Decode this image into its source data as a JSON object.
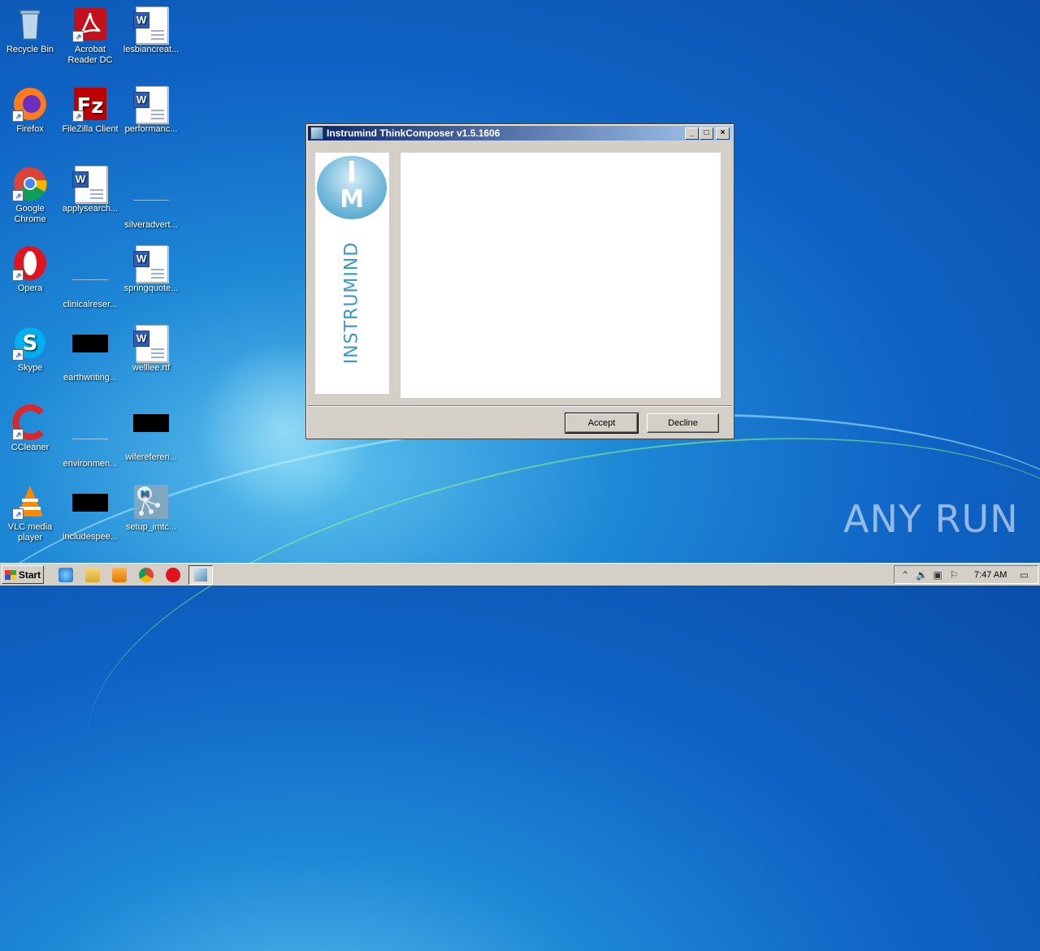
{
  "desktop": {
    "icons": [
      {
        "label": "Recycle Bin",
        "icon": "recycle-bin-icon"
      },
      {
        "label": "Acrobat Reader DC",
        "icon": "acrobat-icon"
      },
      {
        "label": "lesbiancreat...",
        "icon": "word-document-icon"
      },
      {
        "label": "Firefox",
        "icon": "firefox-icon"
      },
      {
        "label": "FileZilla Client",
        "icon": "filezilla-icon"
      },
      {
        "label": "performanc...",
        "icon": "word-document-icon"
      },
      {
        "label": "Google Chrome",
        "icon": "chrome-icon"
      },
      {
        "label": "applysearch...",
        "icon": "word-document-icon"
      },
      {
        "label": "silveradvert...",
        "icon": "blank-file-icon"
      },
      {
        "label": "Opera",
        "icon": "opera-icon"
      },
      {
        "label": "clinicalreser...",
        "icon": "blank-file-icon"
      },
      {
        "label": "springquote...",
        "icon": "word-document-icon"
      },
      {
        "label": "Skype",
        "icon": "skype-icon"
      },
      {
        "label": "earthwriting...",
        "icon": "black-file-icon"
      },
      {
        "label": "welllee.rtf",
        "icon": "word-document-icon"
      },
      {
        "label": "CCleaner",
        "icon": "ccleaner-icon"
      },
      {
        "label": "environmen...",
        "icon": "blank-file-icon"
      },
      {
        "label": "wifereferen...",
        "icon": "black-file-icon"
      },
      {
        "label": "VLC media player",
        "icon": "vlc-icon"
      },
      {
        "label": "includespee...",
        "icon": "black-file-icon"
      },
      {
        "label": "setup_imtc...",
        "icon": "setup-installer-icon"
      }
    ]
  },
  "window": {
    "title": "Instrumind ThinkComposer v1.5.1606",
    "minimize": "_",
    "maximize": "□",
    "close": "×",
    "logo_text": "INSTRUMIND",
    "logo_letters": "M",
    "accept_label": "Accept",
    "decline_label": "Decline"
  },
  "taskbar": {
    "start_label": "Start",
    "clock": "7:47 AM"
  },
  "watermark": "ANY RUN",
  "colors": {
    "desktop_blue": "#0f63c4",
    "title_gradient_start": "#0a246a",
    "title_gradient_end": "#a6caf0",
    "instrumind_blue": "#3d99c4"
  }
}
